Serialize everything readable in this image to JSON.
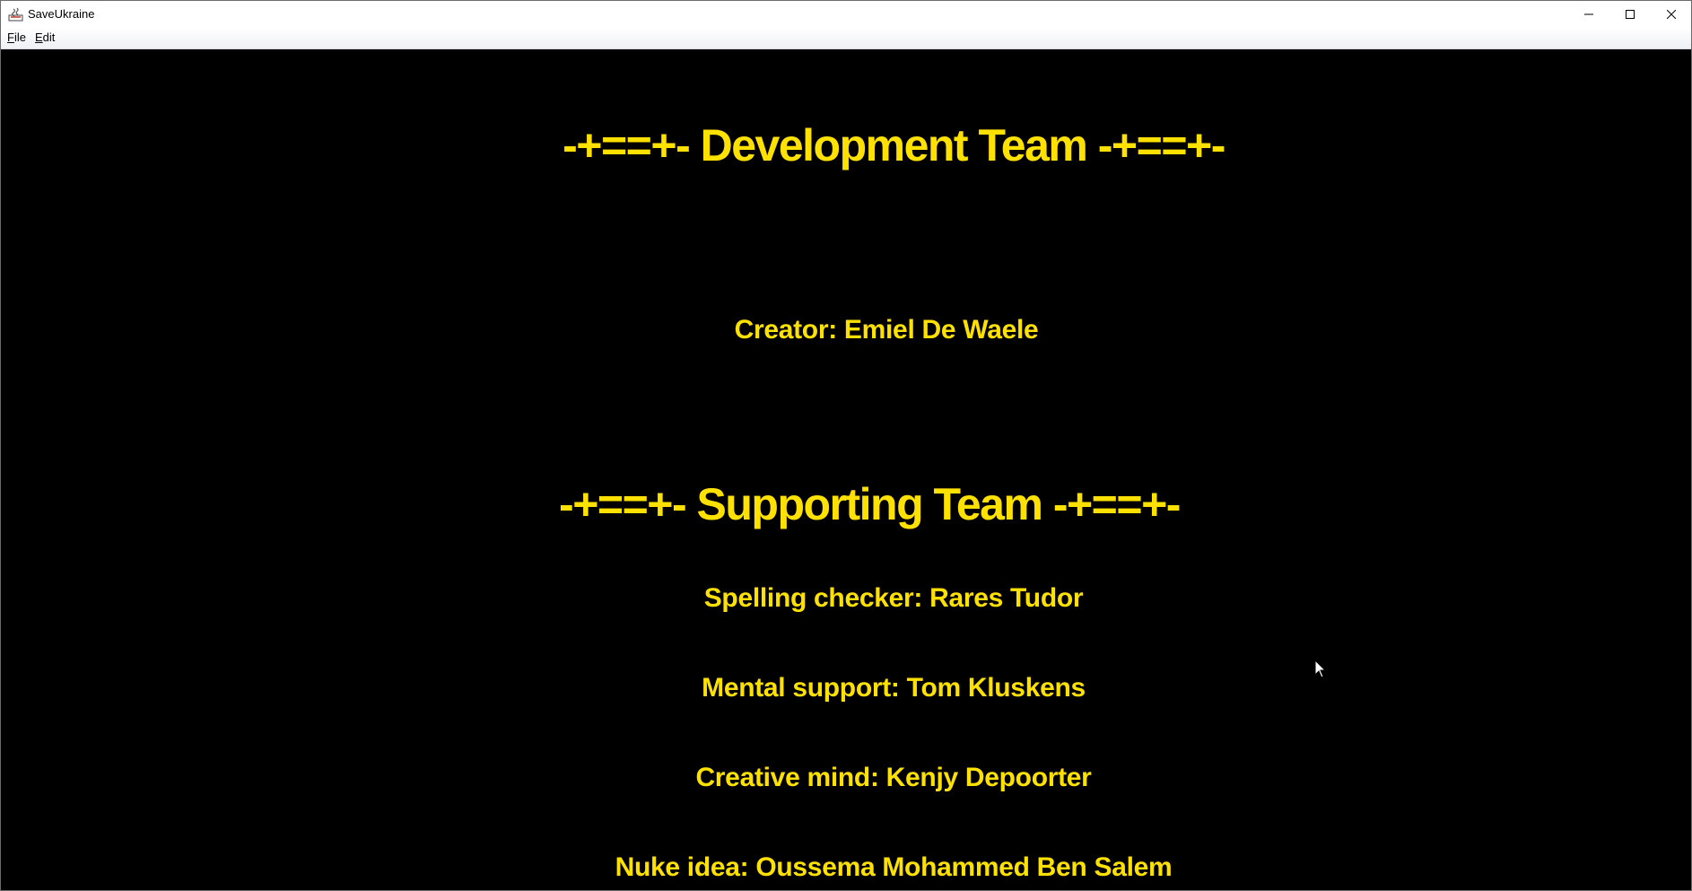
{
  "window": {
    "title": "SaveUkraine",
    "menu": [
      {
        "mnemonic": "F",
        "rest": "ile"
      },
      {
        "mnemonic": "E",
        "rest": "dit"
      }
    ],
    "controls": {
      "minimize_icon": "minimize-icon",
      "maximize_icon": "maximize-icon",
      "close_icon": "close-icon"
    }
  },
  "credits": {
    "background_color": "#000000",
    "text_color": "#ffe100",
    "development_heading": "-+==+- Development Team -+==+-",
    "creator": "Creator: Emiel De Waele",
    "supporting_heading": "-+==+- Supporting Team -+==+-",
    "spelling_checker": "Spelling checker: Rares Tudor",
    "mental_support": "Mental support: Tom Kluskens",
    "creative_mind": "Creative mind: Kenjy Depoorter",
    "nuke_idea": "Nuke idea: Oussema Mohammed Ben Salem"
  }
}
